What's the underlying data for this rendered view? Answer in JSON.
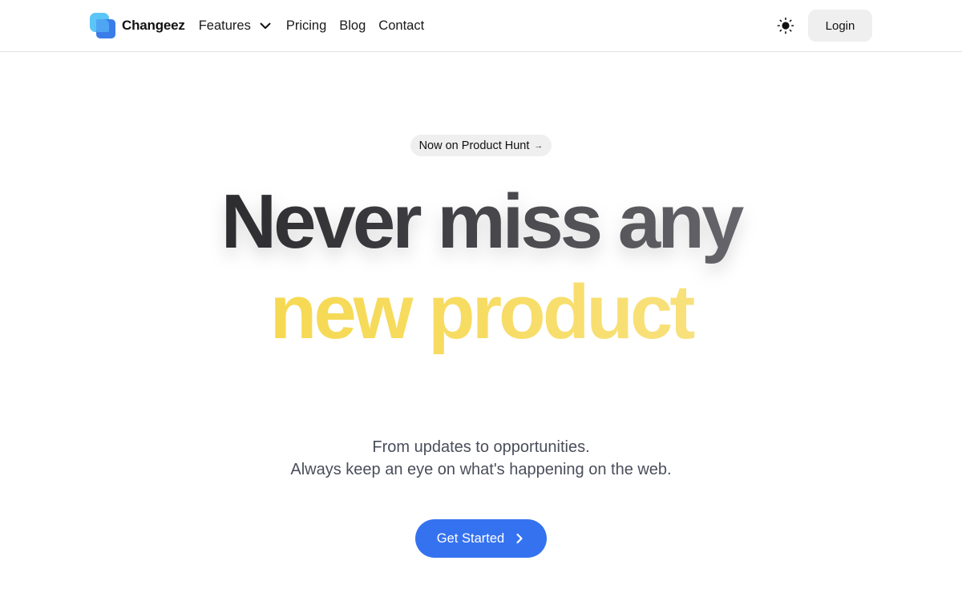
{
  "brand": {
    "name": "Changeez",
    "logo_colors": [
      "#5cc5f7",
      "#3b7de8"
    ]
  },
  "nav": {
    "links": [
      {
        "label": "Features",
        "has_dropdown": true
      },
      {
        "label": "Pricing"
      },
      {
        "label": "Blog"
      },
      {
        "label": "Contact"
      }
    ],
    "theme_toggle_icon": "sun-icon",
    "login_label": "Login"
  },
  "hero": {
    "badge_label": "Now on Product Hunt",
    "badge_arrow": "→",
    "headline_line1": "Never miss any",
    "headline_line2": "new product",
    "subtitle_line1": "From updates to opportunities.",
    "subtitle_line2": "Always keep an eye on what's happening on the web.",
    "cta_label": "Get Started",
    "accent_color": "#3572ef",
    "highlight_color": "#f5d53a"
  }
}
